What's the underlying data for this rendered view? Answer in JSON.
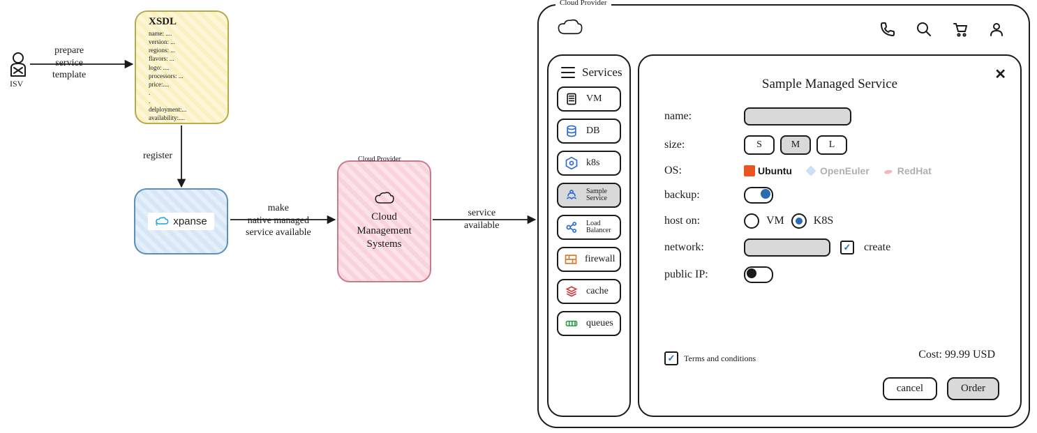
{
  "actor": {
    "label": "ISV"
  },
  "arrows": {
    "prepare": "prepare\nservice\ntemplate",
    "register": "register",
    "make_available": "make\nnative managed\nservice available",
    "service_available": "service\navailable"
  },
  "xsdl": {
    "title": "XSDL",
    "lines": [
      "name: ....",
      "version: ...",
      "regions: ...",
      "flavors: ...",
      "logo: ....",
      "processors: ...",
      "price:....",
      ".",
      ".",
      "delployment:...",
      "availability:...."
    ]
  },
  "xpanse": {
    "name": "xpanse"
  },
  "cms": {
    "provider_label": "Cloud Provider",
    "title": "Cloud\nManagement\nSystems"
  },
  "ui": {
    "provider_label": "Cloud Provider",
    "header_icons": [
      "phone",
      "search",
      "cart",
      "user"
    ],
    "sidebar": {
      "title": "Services",
      "items": [
        {
          "label": "VM",
          "icon": "vm",
          "selected": false
        },
        {
          "label": "DB",
          "icon": "db",
          "selected": false
        },
        {
          "label": "k8s",
          "icon": "k8s",
          "selected": false
        },
        {
          "label": "Sample\nService",
          "icon": "sample",
          "selected": true
        },
        {
          "label": "Load\nBalancer",
          "icon": "lb",
          "selected": false
        },
        {
          "label": "firewall",
          "icon": "fw",
          "selected": false
        },
        {
          "label": "cache",
          "icon": "cache",
          "selected": false
        },
        {
          "label": "queues",
          "icon": "queue",
          "selected": false
        }
      ]
    },
    "detail": {
      "title": "Sample Managed Service",
      "fields": {
        "name": {
          "label": "name:"
        },
        "size": {
          "label": "size:",
          "options": [
            "S",
            "M",
            "L"
          ],
          "selected": "M"
        },
        "os": {
          "label": "OS:",
          "options": [
            "Ubuntu",
            "OpenEuler",
            "RedHat"
          ],
          "selected": "Ubuntu"
        },
        "backup": {
          "label": "backup:",
          "on": true
        },
        "host": {
          "label": "host on:",
          "options": [
            "VM",
            "K8S"
          ],
          "selected": "K8S"
        },
        "network": {
          "label": "network:",
          "create_label": "create",
          "create_checked": true
        },
        "pubip": {
          "label": "public IP:",
          "on": false
        }
      },
      "terms": {
        "label": "Terms and conditions",
        "checked": true
      },
      "cost": {
        "label": "Cost:",
        "value": "99.99 USD"
      },
      "buttons": {
        "cancel": "cancel",
        "order": "Order"
      }
    }
  }
}
